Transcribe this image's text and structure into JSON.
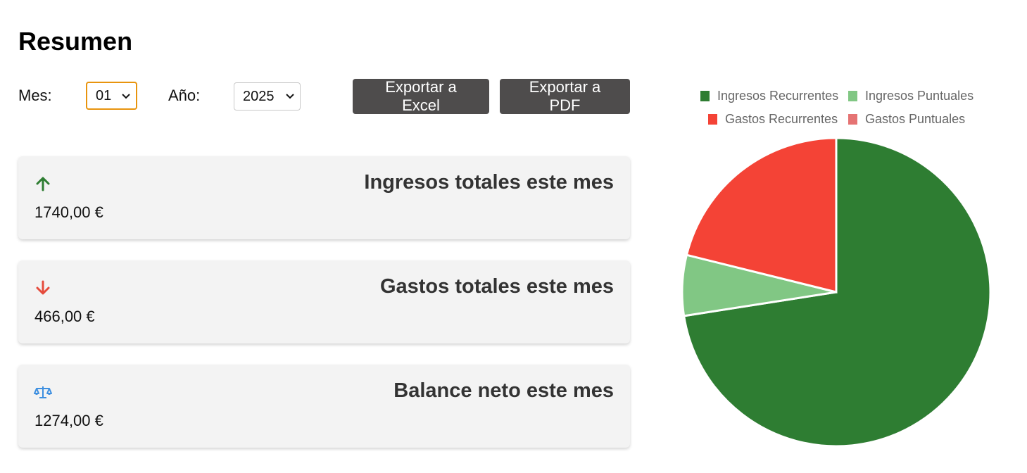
{
  "header": {
    "title": "Resumen"
  },
  "filters": {
    "month_label": "Mes:",
    "month_value": "01",
    "year_label": "Año:",
    "year_value": "2025"
  },
  "actions": {
    "export_excel": "Exportar a Excel",
    "export_pdf": "Exportar a PDF"
  },
  "cards": [
    {
      "title": "Ingresos totales este mes",
      "value": "1740,00 €",
      "icon": "arrow-up-icon",
      "icon_color": "#2e7d32"
    },
    {
      "title": "Gastos totales este mes",
      "value": "466,00 €",
      "icon": "arrow-down-icon",
      "icon_color": "#e54b3c"
    },
    {
      "title": "Balance neto este mes",
      "value": "1274,00 €",
      "icon": "scale-balance-icon",
      "icon_color": "#3d8fe0"
    }
  ],
  "chart_data": {
    "type": "pie",
    "legend_position": "top",
    "labels": [
      "Ingresos Recurrentes",
      "Ingresos Puntuales",
      "Gastos Recurrentes",
      "Gastos Puntuales"
    ],
    "values": [
      1600,
      140,
      466,
      0
    ],
    "colors": [
      "#2e7d32",
      "#81c784",
      "#f44336",
      "#e57373"
    ]
  }
}
